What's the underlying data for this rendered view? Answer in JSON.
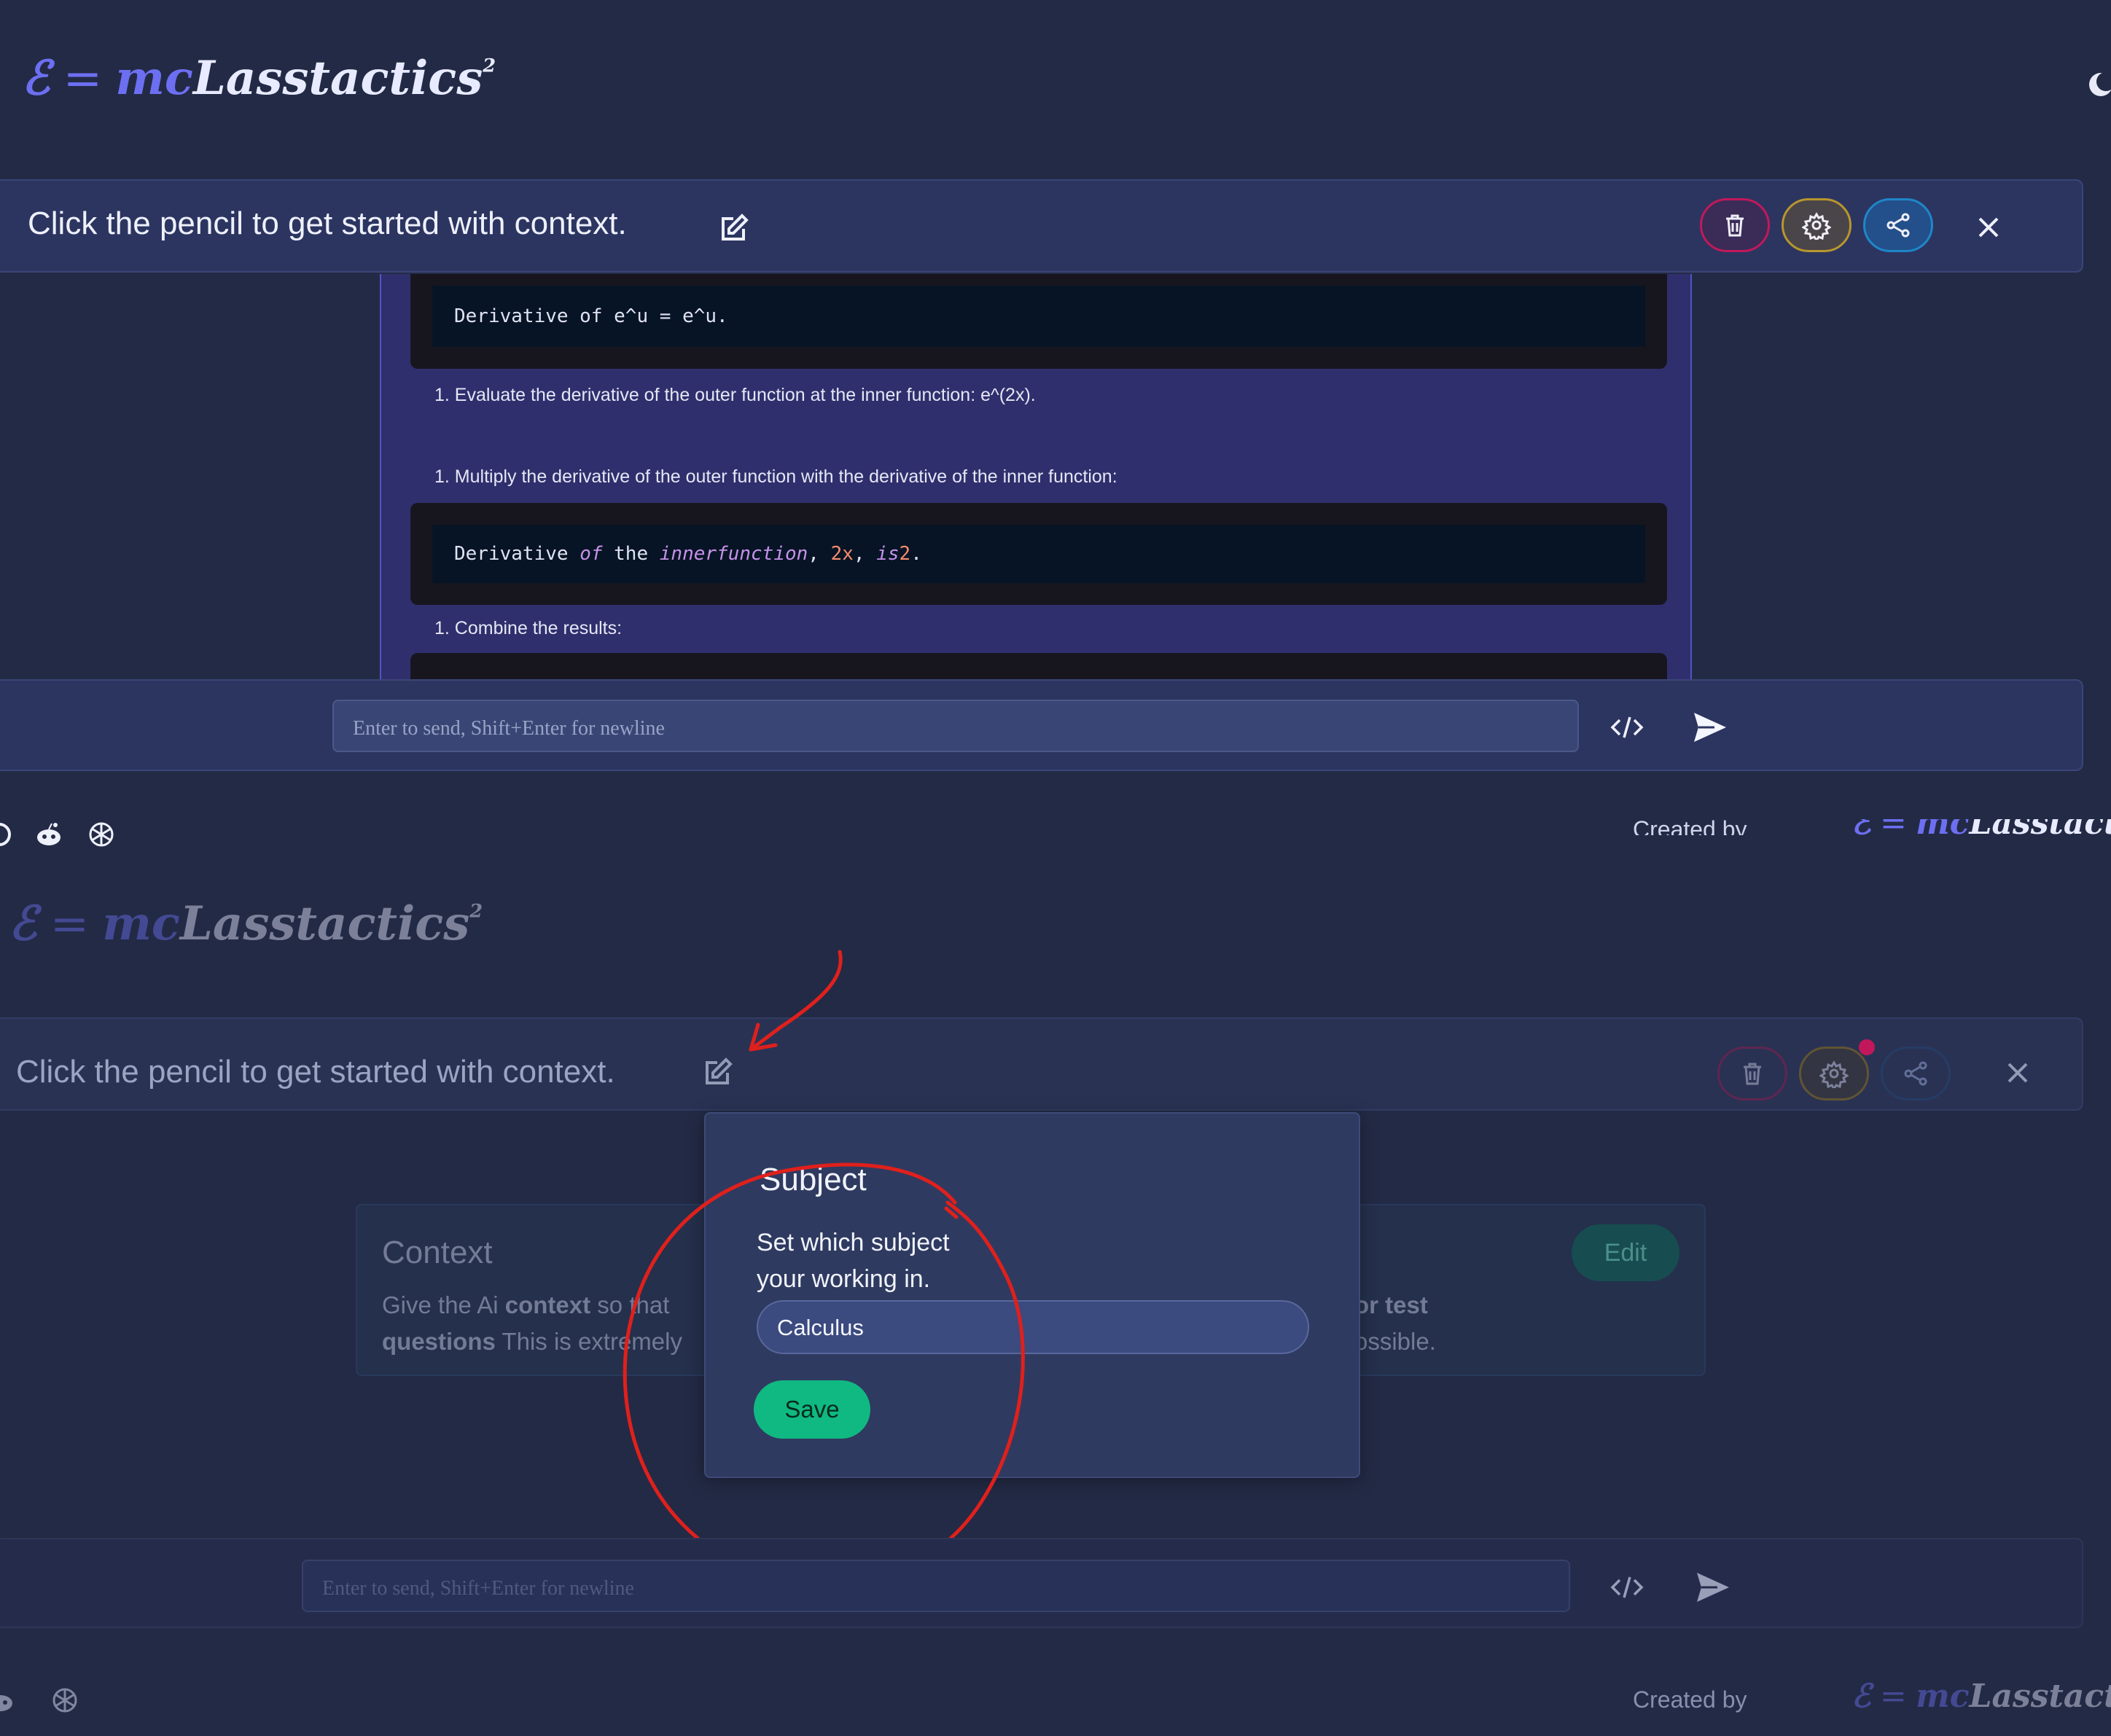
{
  "logo": {
    "e": "ℰ",
    "eq": "=",
    "mc": "mc",
    "name": "Lasstactics",
    "sup": "2"
  },
  "top": {
    "prompt_text": "Click the pencil to get started with context.",
    "chat": {
      "code1": "Derivative of e^u = e^u.",
      "step1": "1. Evaluate the derivative of the outer function at the inner function: e^(2x).",
      "step2": "1. Multiply the derivative of the outer function with the derivative of the inner function:",
      "code2": {
        "a": "Derivative ",
        "of": "of",
        "the": " the ",
        "inner": "inner",
        "function": "function",
        "rest": ", ",
        "two_x": "2x",
        "comma": ", ",
        "is": "is",
        "two": "2",
        "dot": "."
      },
      "step3": "1. Combine the results:"
    },
    "input_placeholder": "Enter to send, Shift+Enter for newline",
    "created_by": "Created by"
  },
  "bottom": {
    "prompt_text": "Click the pencil to get started with context.",
    "context": {
      "title": "Context",
      "text_l1_a": "Give the Ai ",
      "text_l1_b": "context",
      "text_l1_c": " so that",
      "text_l2_a": "questions",
      "text_l2_b": " This is extremely",
      "text_r1": "or test",
      "text_r2": "ossible.",
      "edit_label": "Edit"
    },
    "popover": {
      "title": "Subject",
      "description": "Set which subject your working in.",
      "subject_value": "Calculus",
      "save_label": "Save"
    },
    "input_placeholder": "Enter to send, Shift+Enter for newline",
    "created_by": "Created by"
  },
  "colors": {
    "trash_accent": "#c2185b",
    "gear_accent": "#b8962e",
    "share_accent": "#1f86c9",
    "save_green": "#10b981",
    "annotation_red": "#e0201c"
  },
  "icons": [
    "pencil-icon",
    "trash-icon",
    "gear-icon",
    "share-icon",
    "close-icon",
    "code-icon",
    "send-icon",
    "moon-icon",
    "reddit-icon",
    "openai-icon",
    "arrow-annotation",
    "circle-annotation"
  ]
}
